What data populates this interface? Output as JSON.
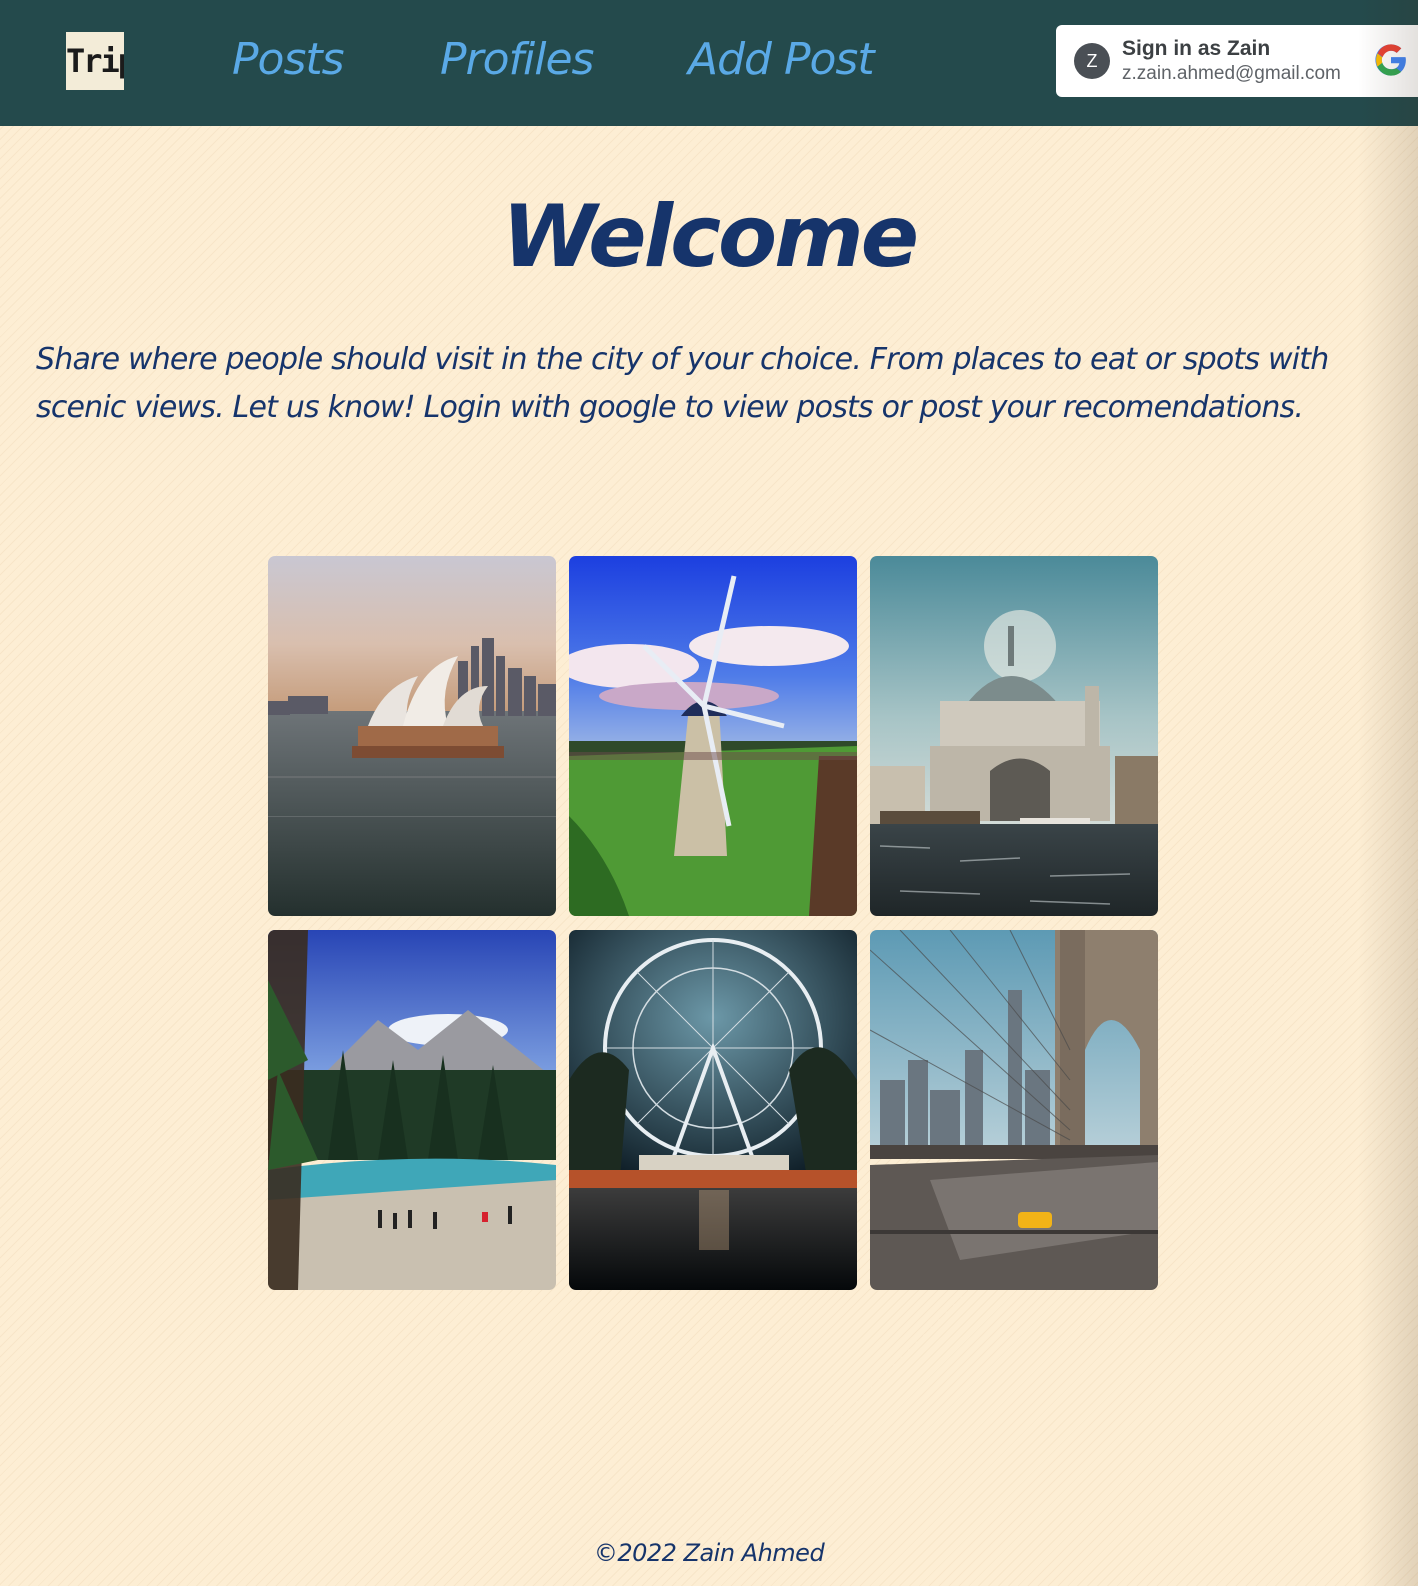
{
  "nav": {
    "logo_text": "Trip",
    "links": [
      "Posts",
      "Profiles",
      "Add Post"
    ]
  },
  "signin": {
    "avatar_letter": "Z",
    "name_line": "Sign in as Zain",
    "email": "z.zain.ahmed@gmail.com",
    "icon": "google-icon"
  },
  "main": {
    "title": "Welcome",
    "intro": "Share where people should visit in the city of your choice. From places to eat or spots with scenic views. Let us know! Login with google to view posts or post your recomendations."
  },
  "gallery": {
    "photos": [
      "sydney-opera-house",
      "windmill-in-field",
      "domed-basilica-on-water",
      "mountain-river-forest",
      "ferris-wheel-palms",
      "bridge-and-city-skyline"
    ]
  },
  "colors": {
    "navbar": "#244a4c",
    "nav_link": "#5aa9e6",
    "heading": "#16346b",
    "page_background": "#fdeed4"
  },
  "footer": {
    "text": "©2022 Zain Ahmed"
  }
}
